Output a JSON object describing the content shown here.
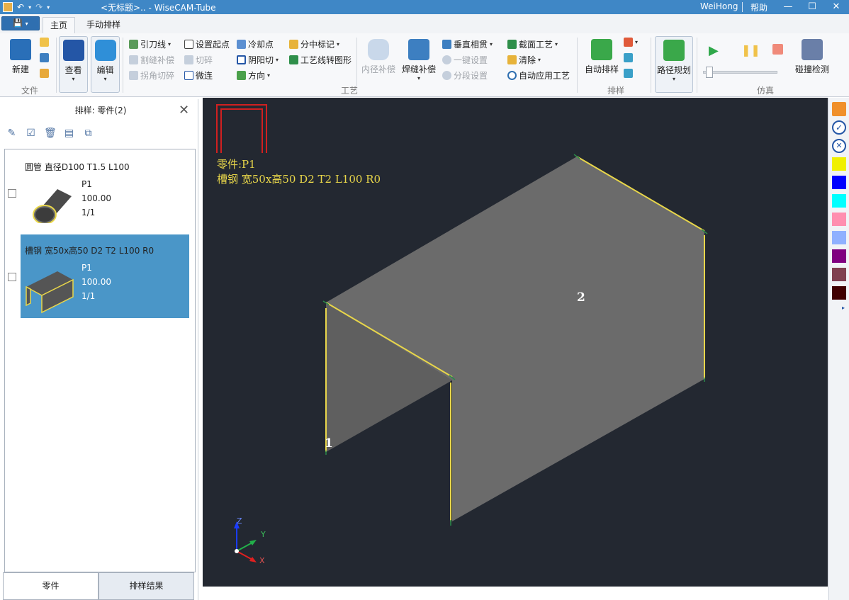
{
  "titlebar": {
    "title": "<无标题>.. - WiseCAM-Tube",
    "user": "WeiHong",
    "help": "帮助"
  },
  "tabs": {
    "file_icon": "save-icon",
    "home": "主页",
    "manual": "手动排样"
  },
  "ribbon": {
    "file": {
      "new": "新建",
      "group": "文件"
    },
    "view": "查看",
    "edit": "编辑",
    "craft": {
      "lead": "引刀线",
      "set_start": "设置起点",
      "cooling": "冷却点",
      "mid_mark": "分中标记",
      "slit_comp": "割缝补偿",
      "cut_break": "切碎",
      "yinyang": "阴阳切",
      "craft_to_shape": "工艺线转图形",
      "corner_cut": "拐角切碎",
      "micro_joint": "微连",
      "direction": "方向",
      "inner_comp": "内径补偿",
      "weld_comp": "焊缝补偿",
      "vert_through": "垂直相贯",
      "one_key": "一键设置",
      "seg_set": "分段设置",
      "section_craft": "截面工艺",
      "clear": "清除",
      "auto_apply": "自动应用工艺",
      "group": "工艺"
    },
    "nest": {
      "auto": "自动排样",
      "group": "排样"
    },
    "path": {
      "plan": "路径规划"
    },
    "sim": {
      "collision": "碰撞检测",
      "group": "仿真"
    }
  },
  "panel": {
    "title": "排样: 零件(2)",
    "items": [
      {
        "name": "圆管 直径D100 T1.5 L100",
        "id": "P1",
        "length": "100.00",
        "count": "1/1"
      },
      {
        "name": "槽钢 宽50x高50 D2 T2 L100 R0",
        "id": "P1",
        "length": "100.00",
        "count": "1/1"
      }
    ],
    "tab_parts": "零件",
    "tab_result": "排样结果"
  },
  "viewport": {
    "part_label": "零件:P1",
    "part_desc": "槽钢 宽50x高50 D2 T2 L100 R0",
    "face1": "1",
    "face2": "2",
    "axis_x": "X",
    "axis_y": "Y",
    "axis_z": "Z"
  },
  "colors": {
    "accent": "#3f87c6",
    "bg": "#232831",
    "edge": "#e8d64a",
    "face": "#6b6b6b",
    "swatches": [
      "#f0f000",
      "#0000ff",
      "#00ffff",
      "#ff8fb0",
      "#8fb0ff",
      "#800080",
      "#804050",
      "#400000"
    ]
  }
}
